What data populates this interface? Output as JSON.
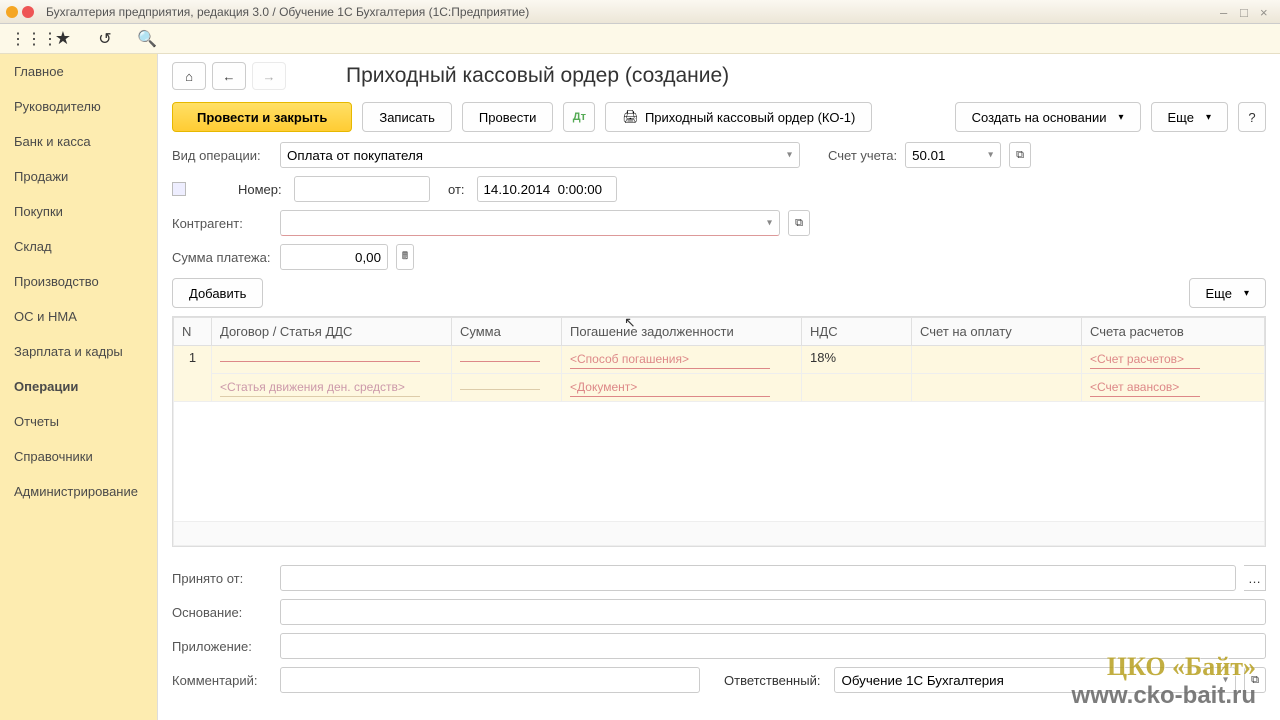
{
  "window": {
    "title": "Бухгалтерия предприятия, редакция 3.0 / Обучение 1С Бухгалтерия  (1С:Предприятие)"
  },
  "sidebar": {
    "items": [
      "Главное",
      "Руководителю",
      "Банк и касса",
      "Продажи",
      "Покупки",
      "Склад",
      "Производство",
      "ОС и НМА",
      "Зарплата и кадры",
      "Операции",
      "Отчеты",
      "Справочники",
      "Администрирование"
    ],
    "active_index": 9
  },
  "page": {
    "title": "Приходный кассовый ордер (создание)"
  },
  "toolbar": {
    "post_close": "Провести и закрыть",
    "write": "Записать",
    "post": "Провести",
    "print_label": "Приходный кассовый ордер (КО-1)",
    "create_based": "Создать на основании",
    "more": "Еще",
    "help": "?"
  },
  "form": {
    "op_type_label": "Вид операции:",
    "op_type_value": "Оплата от покупателя",
    "account_label": "Счет учета:",
    "account_value": "50.01",
    "number_label": "Номер:",
    "number_value": "",
    "date_label": "от:",
    "date_value": "14.10.2014  0:00:00",
    "counterparty_label": "Контрагент:",
    "counterparty_value": "",
    "amount_label": "Сумма платежа:",
    "amount_value": "0,00",
    "add_btn": "Добавить",
    "table_more": "Еще"
  },
  "table": {
    "cols": {
      "n": "N",
      "contract": "Договор / Статья ДДС",
      "sum": "Сумма",
      "repay": "Погашение задолженности",
      "vat": "НДС",
      "invoice": "Счет на оплату",
      "accounts": "Счета расчетов"
    },
    "row": {
      "n": "1",
      "contract_ph": "",
      "dds_ph": "<Статья движения ден. средств>",
      "sum_ph": "",
      "repay_ph": "<Способ погашения>",
      "doc_ph": "<Документ>",
      "vat": "18%",
      "invoice_ph": "",
      "acc_ph": "<Счет расчетов>",
      "adv_ph": "<Счет авансов>"
    }
  },
  "bottom": {
    "received_from": "Принято от:",
    "basis": "Основание:",
    "attachment": "Приложение:",
    "comment": "Комментарий:",
    "responsible_lbl": "Ответственный:",
    "responsible_val": "Обучение 1С Бухгалтерия"
  },
  "watermark": {
    "line1": "ЦКО «Байт»",
    "line2": "www.cko-bait.ru"
  }
}
